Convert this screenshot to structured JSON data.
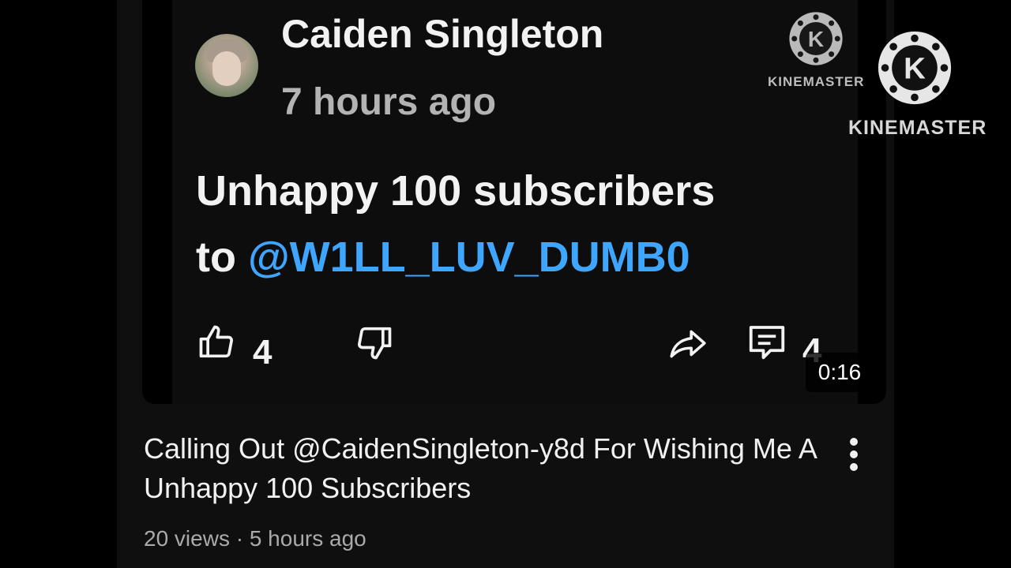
{
  "comment_card": {
    "author": "Caiden Singleton",
    "timestamp": "7 hours ago",
    "text_prefix": "Unhappy 100 subscribers",
    "text_to": "to",
    "mention": "@W1LL_LUV_DUMB0",
    "like_count": "4",
    "reply_count": "4"
  },
  "video": {
    "duration": "0:16",
    "title": "Calling Out @CaidenSingleton-y8d For Wishing Me A Unhappy 100 Subscribers",
    "meta": "20 views · 5 hours ago"
  },
  "watermark": {
    "label_large": "KINEMASTER",
    "label_small": "KINEMASTER",
    "logo_letter": "K"
  },
  "colors": {
    "mention": "#3ea6ff",
    "background": "#0f0f0f"
  }
}
